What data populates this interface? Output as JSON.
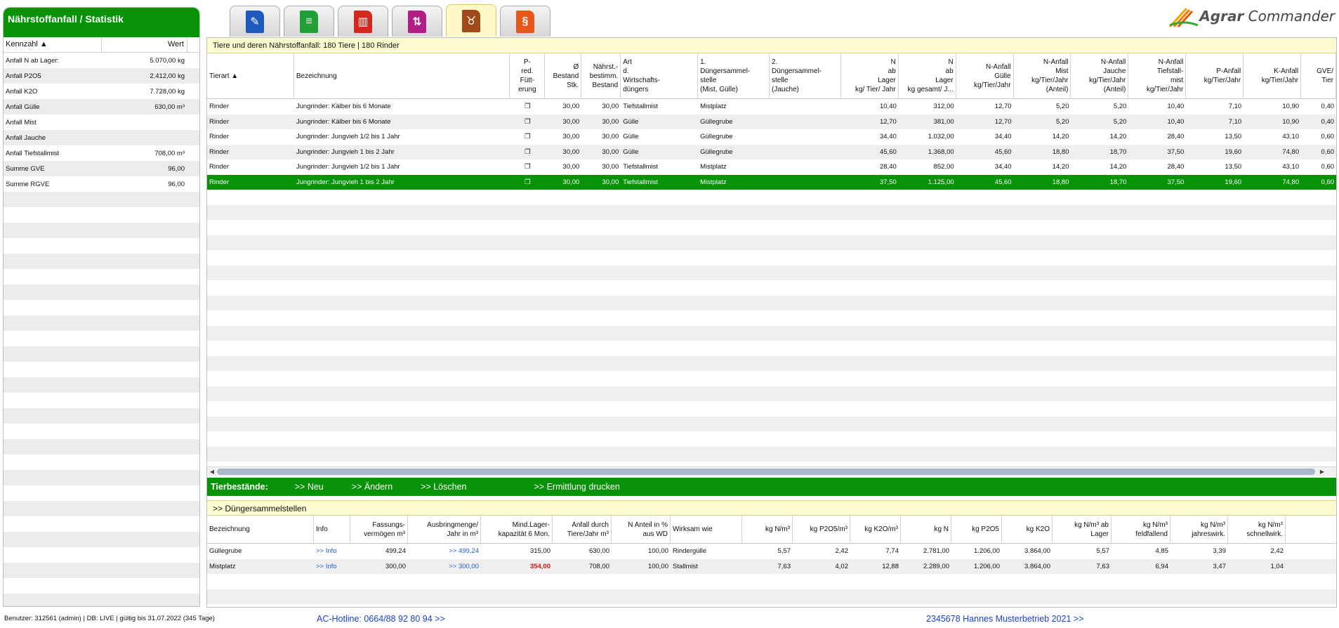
{
  "left_panel": {
    "title": "Nährstoffanfall / Statistik",
    "col_kennzahl": "Kennzahl ▲",
    "col_wert": "Wert",
    "rows": [
      {
        "label": "Anfall N ab Lager:",
        "value": "5.070,00 kg"
      },
      {
        "label": "Anfall P2O5",
        "value": "2.412,00 kg"
      },
      {
        "label": "Anfall K2O",
        "value": "7.728,00 kg"
      },
      {
        "label": "Anfall Gülle",
        "value": "630,00 m³"
      },
      {
        "label": "Anfall Mist",
        "value": ""
      },
      {
        "label": "Anfall Jauche",
        "value": ""
      },
      {
        "label": "Anfall Tiefstallmist",
        "value": "708,00 m³"
      },
      {
        "label": "Summe GVE",
        "value": "96,00"
      },
      {
        "label": "Summe RGVE",
        "value": "96,00"
      }
    ]
  },
  "tabs": [
    {
      "name": "tab-documents",
      "icon": "pen-document-icon",
      "color": "#1f5bbf",
      "glyph": "✎"
    },
    {
      "name": "tab-list",
      "icon": "list-document-icon",
      "color": "#21a038",
      "glyph": "≡"
    },
    {
      "name": "tab-statistics",
      "icon": "bar-chart-icon",
      "color": "#d4281c",
      "glyph": "▥"
    },
    {
      "name": "tab-transfer",
      "icon": "up-down-arrows-icon",
      "color": "#b21e86",
      "glyph": "⇅"
    },
    {
      "name": "tab-animals",
      "icon": "cow-head-icon",
      "color": "#a04a1c",
      "glyph": "♉",
      "active": true
    },
    {
      "name": "tab-legal",
      "icon": "paragraph-icon",
      "color": "#e8571a",
      "glyph": "§"
    }
  ],
  "logo": {
    "brand_a": "Agrar",
    "brand_b": "Commander"
  },
  "animals": {
    "caption": "Tiere und deren Nährstoffanfall: 180 Tiere | 180 Rinder",
    "headers": [
      "Tierart ▲",
      "Bezeichnung",
      "P-\nred.\nFütt-\nerung",
      "Ø\nBestand\nStk.",
      "Nährst.-\nbestimm.\nBestand",
      "Art\nd.\nWirtschafts-\ndüngers",
      "1.\nDüngersammel-\nstelle\n(Mist, Gülle)",
      "2.\nDüngersammel-\nstelle\n(Jauche)",
      "N\nab\nLager\nkg/ Tier/ Jahr",
      "N\nab\nLager\nkg gesamt/ J...",
      "N-Anfall\nGülle\nkg/Tier/Jahr",
      "N-Anfall\nMist\nkg/Tier/Jahr\n(Anteil)",
      "N-Anfall\nJauche\nkg/Tier/Jahr\n(Anteil)",
      "N-Anfall\nTiefstall-\nmist\nkg/Tier/Jahr",
      "P-Anfall\nkg/Tier/Jahr",
      "K-Anfall\nkg/Tier/Jahr",
      "GVE/\nTier"
    ],
    "rows": [
      [
        "Rinder",
        "Jungrinder: Kälber bis 6 Monate",
        "❐",
        "30,00",
        "30,00",
        "Tiefstallmist",
        "Mistplatz",
        "",
        "10,40",
        "312,00",
        "12,70",
        "5,20",
        "5,20",
        "10,40",
        "7,10",
        "10,90",
        "0,40"
      ],
      [
        "Rinder",
        "Jungrinder: Kälber bis 6 Monate",
        "❐",
        "30,00",
        "30,00",
        "Gülle",
        "Güllegrube",
        "",
        "12,70",
        "381,00",
        "12,70",
        "5,20",
        "5,20",
        "10,40",
        "7,10",
        "10,90",
        "0,40"
      ],
      [
        "Rinder",
        "Jungrinder: Jungvieh 1/2 bis 1 Jahr",
        "❐",
        "30,00",
        "30,00",
        "Gülle",
        "Güllegrube",
        "",
        "34,40",
        "1.032,00",
        "34,40",
        "14,20",
        "14,20",
        "28,40",
        "13,50",
        "43,10",
        "0,60"
      ],
      [
        "Rinder",
        "Jungrinder: Jungvieh 1 bis 2 Jahr",
        "❐",
        "30,00",
        "30,00",
        "Gülle",
        "Güllegrube",
        "",
        "45,60",
        "1.368,00",
        "45,60",
        "18,80",
        "18,70",
        "37,50",
        "19,60",
        "74,80",
        "0,60"
      ],
      [
        "Rinder",
        "Jungrinder: Jungvieh 1/2 bis 1 Jahr",
        "❐",
        "30,00",
        "30,00",
        "Tiefstallmist",
        "Mistplatz",
        "",
        "28,40",
        "852,00",
        "34,40",
        "14,20",
        "14,20",
        "28,40",
        "13,50",
        "43,10",
        "0,60"
      ],
      [
        "Rinder",
        "Jungrinder: Jungvieh 1 bis 2 Jahr",
        "❐",
        "30,00",
        "30,00",
        "Tiefstallmist",
        "Mistplatz",
        "",
        "37,50",
        "1.125,00",
        "45,60",
        "18,80",
        "18,70",
        "37,50",
        "19,60",
        "74,80",
        "0,60"
      ]
    ],
    "selected_index": 5
  },
  "action_bar": {
    "title": "Tierbestände:",
    "new": ">> Neu",
    "edit": ">> Ändern",
    "delete": ">> Löschen",
    "print": ">> Ermittlung drucken"
  },
  "stores": {
    "caption": ">> Düngersammelstellen",
    "headers": [
      "Bezeichnung",
      "Info",
      "Fassungs-\nvermögen m³",
      "Ausbringmenge/\nJahr in m³",
      "Mind.Lager-\nkapazität 6 Mon.",
      "Anfall durch\nTiere/Jahr m³",
      "N Anteil in %\naus WD",
      "Wirksam wie",
      "kg N/m³",
      "kg P2O5/m³",
      "kg K2O/m³",
      "kg N",
      "kg P2O5",
      "kg K2O",
      "kg N/m³ ab\nLager",
      "kg N/m³\nfeldfallend",
      "kg N/m³\njahreswirk.",
      "kg N/m³\nschnellwirk."
    ],
    "rows": [
      [
        "Güllegrube",
        ">> Info",
        "499,24",
        ">> 499,24",
        "315,00",
        "630,00",
        "100,00",
        "Rindergülle",
        "5,57",
        "2,42",
        "7,74",
        "2.781,00",
        "1.206,00",
        "3.864,00",
        "5,57",
        "4,85",
        "3,39",
        "2,42"
      ],
      [
        "Mistplatz",
        ">> Info",
        "300,00",
        ">> 300,00",
        "354,00",
        "708,00",
        "100,00",
        "Stallmist",
        "7,63",
        "4,02",
        "12,88",
        "2.289,00",
        "1.206,00",
        "3.864,00",
        "7,63",
        "6,94",
        "3,47",
        "1,04"
      ]
    ]
  },
  "footer": {
    "user": "Benutzer: 312561 (admin) | DB: LIVE | gültig bis 31.07.2022 (345 Tage)",
    "hotline": "AC-Hotline: 0664/88 92 80 94 >>",
    "betrieb": "2345678 Hannes Musterbetrieb 2021 >>"
  },
  "colors": {
    "accent_green": "#079207",
    "caption_yellow": "#fdfbd0",
    "link_blue": "#1d5fd0",
    "warning_red": "#e01010"
  }
}
